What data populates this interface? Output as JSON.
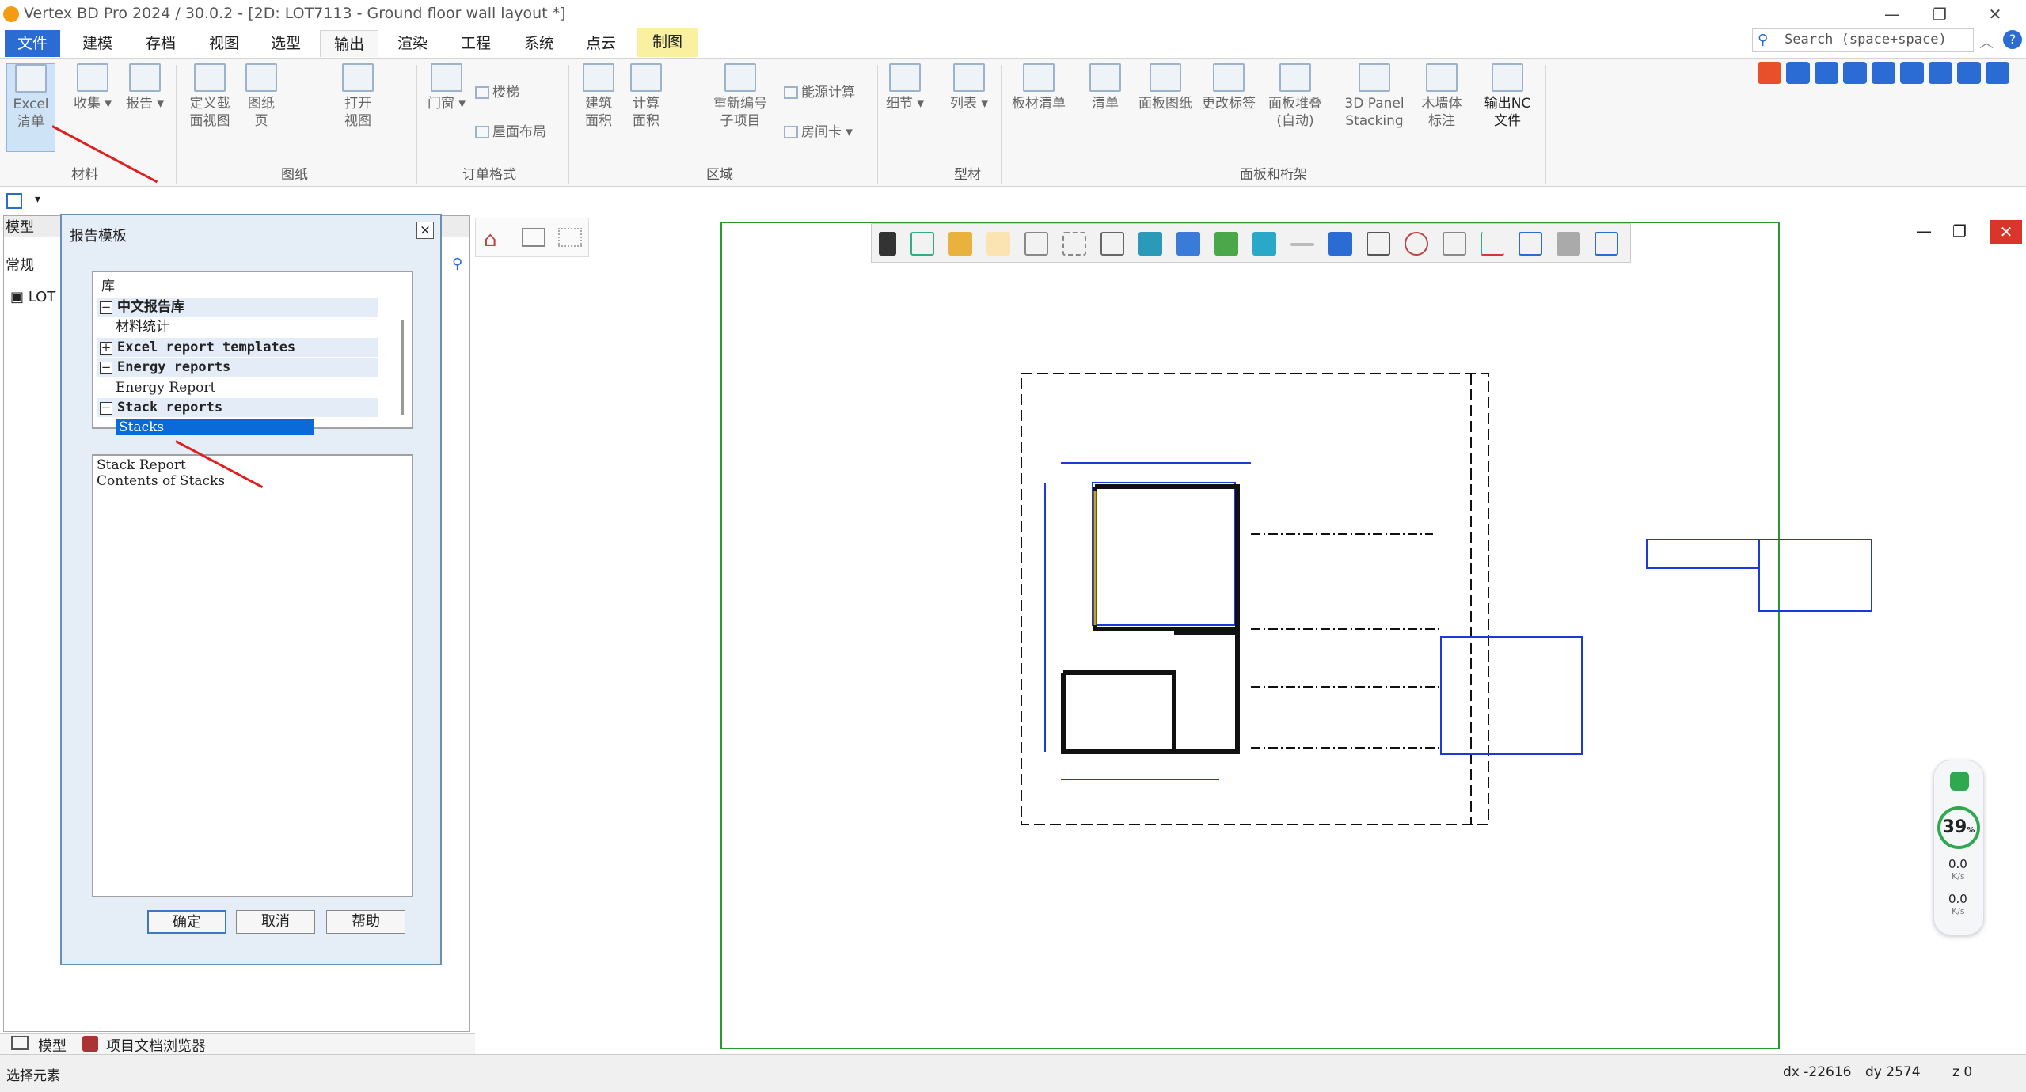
{
  "window": {
    "title": "Vertex BD Pro 2024 / 30.0.2 - [2D: LOT7113 - Ground floor wall layout *]"
  },
  "tabs": [
    "文件",
    "建模",
    "存档",
    "视图",
    "选型",
    "输出",
    "渲染",
    "工程",
    "系统",
    "点云",
    "制图"
  ],
  "ribbon": {
    "materials": {
      "excel": "Excel\n清单",
      "collect": "收集",
      "report": "报告",
      "group": "材料"
    },
    "drawings": {
      "define": "定义截\n面视图",
      "sheet": "图纸\n页",
      "open": "打开\n视图",
      "group": "图纸"
    },
    "order": {
      "door": "门窗",
      "stairs": "楼梯",
      "roof": "屋面布局",
      "group": "订单格式"
    },
    "area": {
      "building": "建筑\n面积",
      "calc": "计算\n面积",
      "renumber": "重新编号\n子项目",
      "energy": "能源计算",
      "roomcard": "房间卡",
      "group": "区域"
    },
    "profiles": {
      "detail": "细节",
      "list": "列表",
      "group": "型材"
    },
    "panels": {
      "panel_list": "板材清单",
      "list": "清单",
      "panel_drawing": "面板图纸",
      "change_label": "更改标签",
      "stack_auto": "面板堆叠\n(自动)",
      "stacking": "3D Panel\nStacking",
      "timber": "木墙体\n标注",
      "nc": "输出NC\n文件",
      "group": "面板和桁架"
    }
  },
  "search": {
    "placeholder": "Search (space+space)"
  },
  "left_panel": {
    "title": "模型",
    "filter": "常规",
    "root": "LOT",
    "bottom_tabs": [
      "模型",
      "项目文档浏览器"
    ]
  },
  "dialog": {
    "title": "报告模板",
    "tree": [
      {
        "label": "库",
        "kind": "root"
      },
      {
        "label": "中文报告库",
        "kind": "group",
        "expander": "−"
      },
      {
        "label": "材料统计",
        "kind": "leaf"
      },
      {
        "label": "Excel report templates",
        "kind": "group",
        "expander": "+"
      },
      {
        "label": "Energy reports",
        "kind": "group",
        "expander": "−"
      },
      {
        "label": "Energy Report",
        "kind": "leaf"
      },
      {
        "label": "Stack reports",
        "kind": "group",
        "expander": "−"
      },
      {
        "label": "Stacks",
        "kind": "selected"
      }
    ],
    "description": [
      "Stack Report",
      "Contents of Stacks"
    ],
    "buttons": {
      "ok": "确定",
      "cancel": "取消",
      "help": "帮助"
    }
  },
  "status": {
    "prompt": "选择元素",
    "dx": "dx -22616",
    "dy": "dy 2574",
    "z": "z 0"
  },
  "net_widget": {
    "percent": "39",
    "unit": "%",
    "up": "0.0",
    "down": "0.0",
    "rate_unit": "K/s"
  },
  "colors": {
    "accent": "#2b6cd4",
    "selection": "#0a6ad8",
    "frame": "#2a9a2a",
    "drawing": "#1a3bd8"
  }
}
